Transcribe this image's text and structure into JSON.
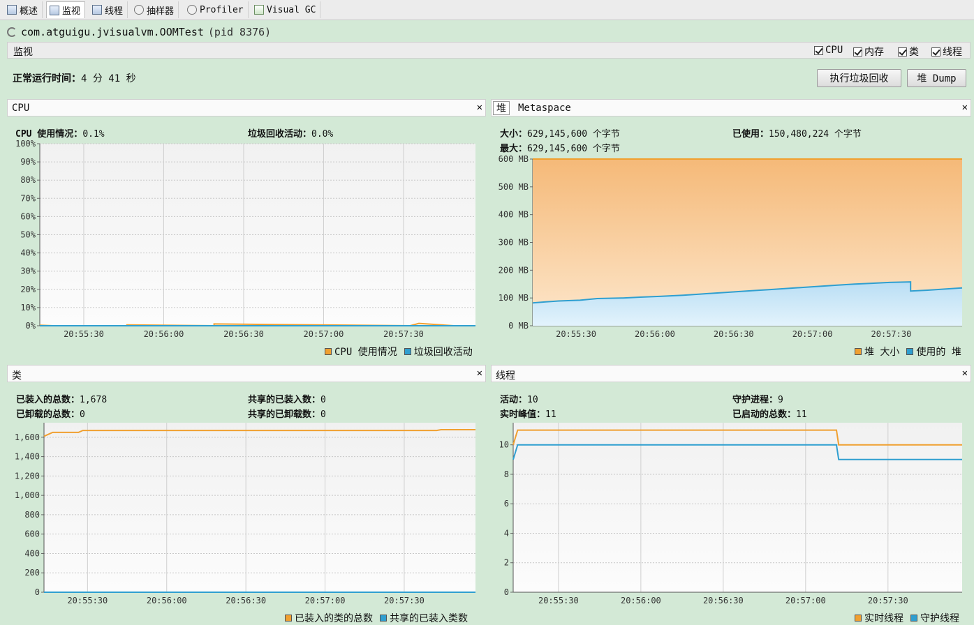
{
  "tabs": [
    {
      "label": "概述"
    },
    {
      "label": "监视"
    },
    {
      "label": "线程"
    },
    {
      "label": "抽样器"
    },
    {
      "label": "Profiler"
    },
    {
      "label": "Visual GC"
    }
  ],
  "app_title": "com.atguigu.jvisualvm.OOMTest",
  "app_pid": "(pid 8376)",
  "monitor": {
    "label": "监视",
    "checkboxes": [
      "CPU",
      "内存",
      "类",
      "线程"
    ]
  },
  "uptime": {
    "label": "正常运行时间：",
    "value": "4 分 41 秒"
  },
  "buttons": {
    "gc": "执行垃圾回收",
    "heap_dump": "堆 Dump"
  },
  "colors": {
    "orange": "#f0a030",
    "blue": "#2f9fd0"
  },
  "cpu_panel": {
    "title": "CPU",
    "usage_label": "CPU 使用情况：",
    "usage_value": "0.1%",
    "gc_label": "垃圾回收活动：",
    "gc_value": "0.0%",
    "legend": [
      "CPU 使用情况",
      "垃圾回收活动"
    ]
  },
  "heap_panel": {
    "tab_heap": "堆",
    "tab_meta": "Metaspace",
    "size_label": "大小：",
    "size_value": "629,145,600 个字节",
    "max_label": "最大：",
    "max_value": "629,145,600 个字节",
    "used_label": "已使用：",
    "used_value": "150,480,224 个字节",
    "legend": [
      "堆 大小",
      "使用的 堆"
    ]
  },
  "class_panel": {
    "title": "类",
    "loaded_label": "已装入的总数：",
    "loaded_value": "1,678",
    "unloaded_label": "已卸载的总数：",
    "unloaded_value": "0",
    "shared_loaded_label": "共享的已装入数：",
    "shared_loaded_value": "0",
    "shared_unloaded_label": "共享的已卸载数：",
    "shared_unloaded_value": "0",
    "legend": [
      "已装入的类的总数",
      "共享的已装入类数"
    ]
  },
  "thread_panel": {
    "title": "线程",
    "live_label": "活动：",
    "live_value": "10",
    "peak_label": "实时峰值：",
    "peak_value": "11",
    "daemon_label": "守护进程：",
    "daemon_value": "9",
    "started_label": "已启动的总数：",
    "started_value": "11",
    "legend": [
      "实时线程",
      "守护线程"
    ]
  },
  "chart_data": [
    {
      "type": "line",
      "name": "cpu",
      "x_ticks": [
        "20:55:30",
        "20:56:00",
        "20:56:30",
        "20:57:00",
        "20:57:30"
      ],
      "y_ticks": [
        "100%",
        "90%",
        "80%",
        "70%",
        "60%",
        "50%",
        "40%",
        "30%",
        "20%",
        "10%",
        "0%"
      ],
      "ylim": [
        0,
        100
      ],
      "series": [
        {
          "name": "CPU 使用情况",
          "color": "#f0a030",
          "x": [
            0,
            0.03,
            0.2,
            0.2,
            0.4,
            0.4,
            0.85,
            0.87,
            0.95,
            1
          ],
          "values": [
            0.3,
            0,
            0,
            0.5,
            0,
            1,
            0,
            1.3,
            0,
            0
          ]
        },
        {
          "name": "垃圾回收活动",
          "color": "#2f9fd0",
          "x": [
            0,
            1
          ],
          "values": [
            0,
            0
          ]
        }
      ]
    },
    {
      "type": "area",
      "name": "heap",
      "x_ticks": [
        "20:55:30",
        "20:56:00",
        "20:56:30",
        "20:57:00",
        "20:57:30"
      ],
      "y_ticks": [
        "600 MB",
        "500 MB",
        "400 MB",
        "300 MB",
        "200 MB",
        "100 MB",
        "0 MB"
      ],
      "ylim": [
        0,
        600
      ],
      "series": [
        {
          "name": "堆 大小",
          "color": "#f0a030",
          "x": [
            0,
            1
          ],
          "values": [
            600,
            600
          ]
        },
        {
          "name": "使用的 堆",
          "color": "#2f9fd0",
          "x": [
            0,
            0.03,
            0.06,
            0.11,
            0.15,
            0.21,
            0.25,
            0.3,
            0.35,
            0.39,
            0.43,
            0.47,
            0.51,
            0.55,
            0.59,
            0.63,
            0.67,
            0.71,
            0.75,
            0.79,
            0.83,
            0.88,
            0.88,
            0.92,
            0.96,
            1
          ],
          "values": [
            82,
            86,
            89,
            92,
            98,
            100,
            103,
            106,
            110,
            114,
            118,
            122,
            126,
            130,
            134,
            138,
            142,
            146,
            150,
            153,
            156,
            158,
            125,
            128,
            132,
            136
          ]
        }
      ]
    },
    {
      "type": "line",
      "name": "classes",
      "x_ticks": [
        "20:55:30",
        "20:56:00",
        "20:56:30",
        "20:57:00",
        "20:57:30"
      ],
      "y_ticks": [
        "1,600",
        "1,400",
        "1,200",
        "1,000",
        "800",
        "600",
        "400",
        "200",
        "0"
      ],
      "ylim": [
        0,
        1750
      ],
      "series": [
        {
          "name": "已装入的类的总数",
          "color": "#f0a030",
          "x": [
            0,
            0.01,
            0.02,
            0.08,
            0.09,
            0.91,
            0.92,
            1
          ],
          "values": [
            1610,
            1630,
            1650,
            1650,
            1670,
            1670,
            1678,
            1678
          ]
        },
        {
          "name": "共享的已装入类数",
          "color": "#2f9fd0",
          "x": [
            0,
            1
          ],
          "values": [
            0,
            0
          ]
        }
      ]
    },
    {
      "type": "line",
      "name": "threads",
      "x_ticks": [
        "20:55:30",
        "20:56:00",
        "20:56:30",
        "20:57:00",
        "20:57:30"
      ],
      "y_ticks": [
        "10",
        "8",
        "6",
        "4",
        "2",
        "0"
      ],
      "ylim": [
        0,
        11.5
      ],
      "series": [
        {
          "name": "实时线程",
          "color": "#f0a030",
          "x": [
            0,
            0.01,
            0.72,
            0.725,
            1
          ],
          "values": [
            10,
            11,
            11,
            10,
            10
          ]
        },
        {
          "name": "守护线程",
          "color": "#2f9fd0",
          "x": [
            0,
            0.01,
            0.72,
            0.725,
            1
          ],
          "values": [
            9,
            10,
            10,
            9,
            9
          ]
        }
      ]
    }
  ]
}
